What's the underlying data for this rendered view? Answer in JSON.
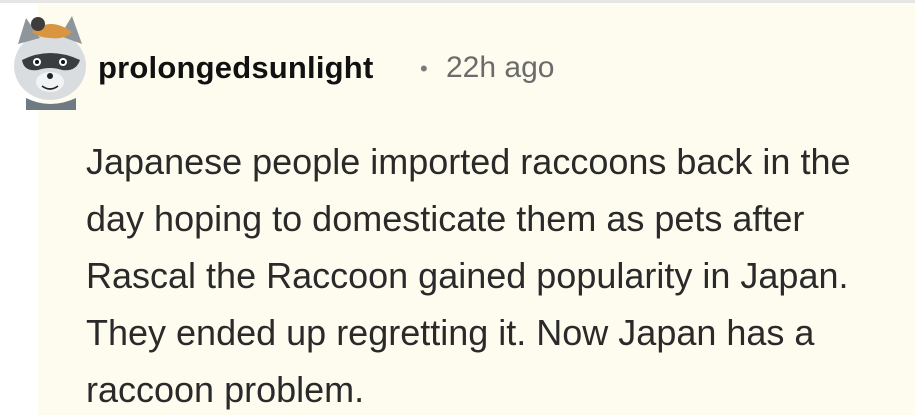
{
  "comment": {
    "author": "prolongedsunlight",
    "separator": "•",
    "time_ago": "22h ago",
    "text": "Japanese people imported raccoons back in the day hoping to domesticate them as pets after Rascal the Raccoon gained popularity in Japan. They ended up regretting it. Now Japan has a raccoon problem.",
    "avatar_icon": "raccoon-avatar-icon"
  },
  "colors": {
    "card_background": "#fefcef",
    "author_text": "#111111",
    "meta_text": "#6b6b6b",
    "body_text": "#2a2a2a"
  }
}
